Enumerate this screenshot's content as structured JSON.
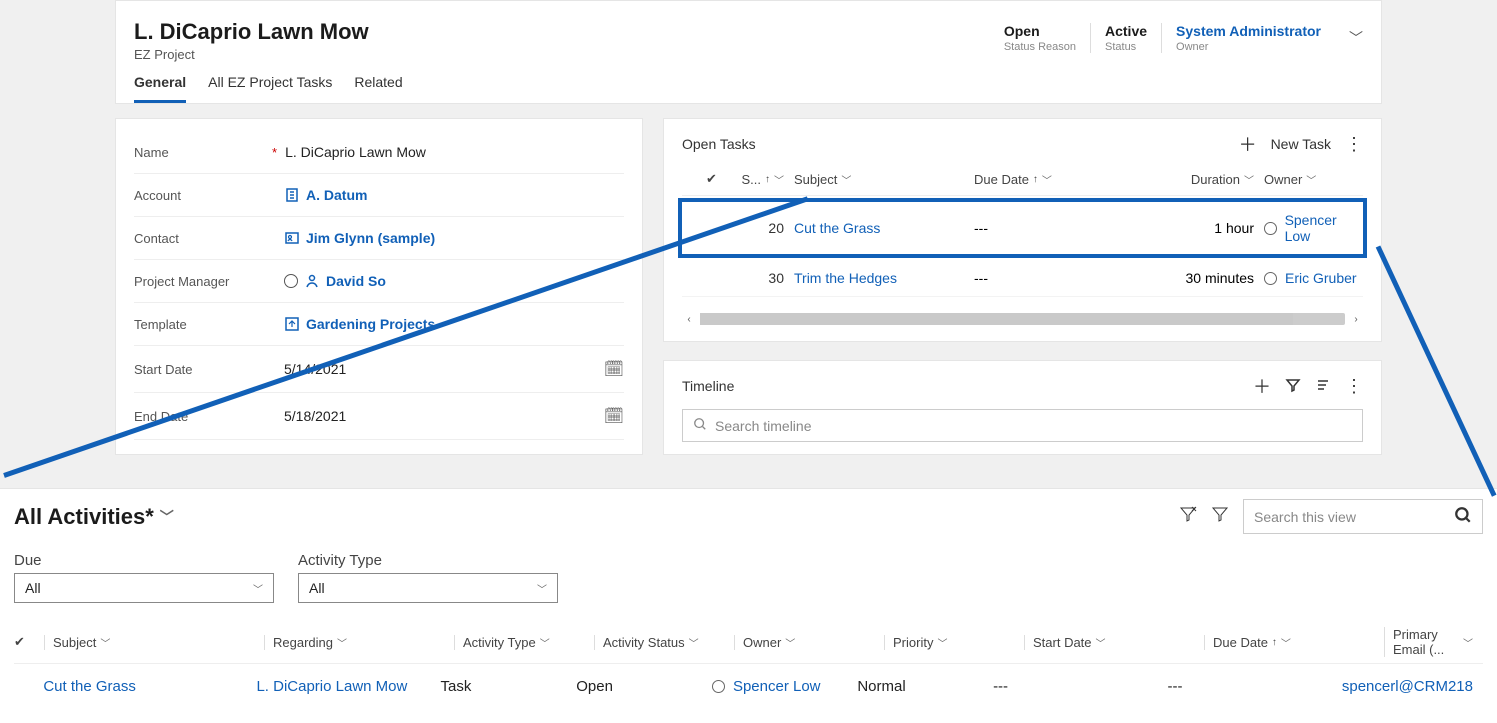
{
  "header": {
    "title": "L. DiCaprio Lawn Mow",
    "subtitle": "EZ Project",
    "meta": [
      {
        "value": "Open",
        "label": "Status Reason",
        "link": false
      },
      {
        "value": "Active",
        "label": "Status",
        "link": false
      },
      {
        "value": "System Administrator",
        "label": "Owner",
        "link": true
      }
    ]
  },
  "tabs": [
    "General",
    "All EZ Project Tasks",
    "Related"
  ],
  "form": {
    "name": {
      "label": "Name",
      "value": "L. DiCaprio Lawn Mow",
      "required": true
    },
    "account": {
      "label": "Account",
      "value": "A. Datum"
    },
    "contact": {
      "label": "Contact",
      "value": "Jim Glynn (sample)"
    },
    "pm": {
      "label": "Project Manager",
      "value": "David So"
    },
    "template": {
      "label": "Template",
      "value": "Gardening Projects"
    },
    "start": {
      "label": "Start Date",
      "value": "5/14/2021"
    },
    "end": {
      "label": "End Date",
      "value": "5/18/2021"
    }
  },
  "openTasks": {
    "title": "Open Tasks",
    "newTask": "New Task",
    "cols": {
      "s": "S...",
      "subject": "Subject",
      "due": "Due Date",
      "dur": "Duration",
      "owner": "Owner"
    },
    "rows": [
      {
        "s": "20",
        "subject": "Cut the Grass",
        "due": "---",
        "dur": "1 hour",
        "owner": "Spencer Low"
      },
      {
        "s": "30",
        "subject": "Trim the Hedges",
        "due": "---",
        "dur": "30 minutes",
        "owner": "Eric Gruber"
      }
    ]
  },
  "timeline": {
    "title": "Timeline",
    "searchPlaceholder": "Search timeline"
  },
  "activities": {
    "title": "All Activities*",
    "searchPlaceholder": "Search this view",
    "filters": {
      "due": {
        "label": "Due",
        "value": "All"
      },
      "type": {
        "label": "Activity Type",
        "value": "All"
      }
    },
    "cols": {
      "subject": "Subject",
      "regarding": "Regarding",
      "atype": "Activity Type",
      "astatus": "Activity Status",
      "owner": "Owner",
      "priority": "Priority",
      "sdate": "Start Date",
      "ddate": "Due Date",
      "pemail": "Primary Email (..."
    },
    "rows": [
      {
        "subject": "Cut the Grass",
        "regarding": "L. DiCaprio Lawn Mow",
        "atype": "Task",
        "astatus": "Open",
        "owner": "Spencer Low",
        "priority": "Normal",
        "sdate": "---",
        "ddate": "---",
        "pemail": "spencerl@CRM218"
      }
    ]
  }
}
